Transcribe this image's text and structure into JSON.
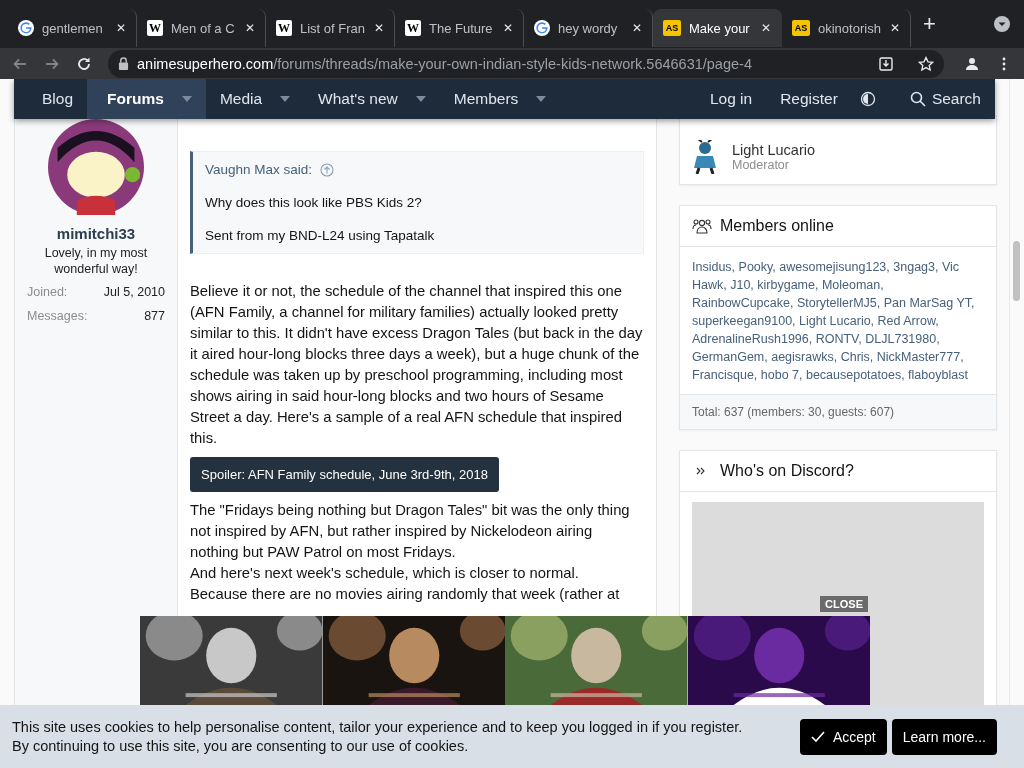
{
  "browser": {
    "tabs": [
      {
        "title": "gentlemen",
        "kind": "google",
        "selected": false
      },
      {
        "title": "Men of a C",
        "kind": "wiki",
        "badge": "W",
        "selected": false
      },
      {
        "title": "List of Fran",
        "kind": "wiki",
        "badge": "W",
        "selected": false
      },
      {
        "title": "The Future",
        "kind": "wiki",
        "badge": "W",
        "selected": false
      },
      {
        "title": "hey wordy",
        "kind": "google",
        "selected": false
      },
      {
        "title": "Make your",
        "kind": "as",
        "badge": "AS",
        "selected": true
      },
      {
        "title": "okinotorish",
        "kind": "as",
        "badge": "AS",
        "selected": false
      }
    ],
    "new_tab": "+",
    "close_glyph": "✕",
    "url_domain": "animesuperhero.com",
    "url_path": "/forums/threads/make-your-own-indian-style-kids-network.5646631/page-4"
  },
  "nav": {
    "items": [
      {
        "label": "Blog",
        "dropdown": false,
        "selected": false
      },
      {
        "label": "Forums",
        "dropdown": true,
        "selected": true
      },
      {
        "label": "Media",
        "dropdown": true,
        "selected": false
      },
      {
        "label": "What's new",
        "dropdown": true,
        "selected": false
      },
      {
        "label": "Members",
        "dropdown": true,
        "selected": false
      }
    ],
    "login": "Log in",
    "register": "Register",
    "search": "Search"
  },
  "post": {
    "user": {
      "name": "mimitchi33",
      "title": "Lovely, in my most wonderful way!",
      "stats": [
        {
          "label": "Joined:",
          "value": "Jul 5, 2010"
        },
        {
          "label": "Messages:",
          "value": "877"
        }
      ]
    },
    "quote": {
      "author": "Vaughn Max said:",
      "lines": [
        "Why does this look like PBS Kids 2?",
        "Sent from my BND-L24 using Tapatalk"
      ]
    },
    "paragraph": "Believe it or not, the schedule of the channel that inspired this one (AFN Family, a channel for military families) actually looked pretty similar to this. It didn't have excess Dragon Tales (but back in the day it aired hour-long blocks three days a week), but a huge chunk of the schedule was taken up by preschool programming, including most shows airing in said hour-long blocks and two hours of Sesame Street a day. Here's a sample of a real AFN schedule that inspired this.",
    "spoiler": "Spoiler: AFN Family schedule, June 3rd-9th, 2018",
    "after": [
      "The \"Fridays being nothing but Dragon Tales\" bit was the only thing not inspired by AFN, but rather inspired by Nickelodeon airing nothing but PAW Patrol on most Fridays.",
      "And here's next week's schedule, which is closer to normal.",
      "Because there are no movies airing randomly that week (rather at"
    ]
  },
  "sidebar": {
    "staff": [
      {
        "name": "Light Lucario",
        "role": "Moderator"
      }
    ],
    "members_online": {
      "title": "Members online",
      "names": "Insidus, Pooky, awesomejisung123, 3ngag3, Vic Hawk, J10, kirbygame, Moleoman, RainbowCupcake, StorytellerMJ5, Pan MarSag YT, superkeegan9100, Light Lucario, Red Arrow, AdrenalineRush1996, RONTV, DLJL731980, GermanGem, aegisrawks, Chris, NickMaster777, Francisque, hobo 7, becausepotatoes, flaboyblast",
      "total": "Total: 637 (members: 30, guests: 607)"
    },
    "discord": {
      "title": "Who's on Discord?"
    }
  },
  "ad": {
    "close": "CLOSE"
  },
  "cookie": {
    "lines": [
      "This site uses cookies to help personalise content, tailor your experience and to keep you logged in if you register.",
      "By continuing to use this site, you are consenting to our use of cookies."
    ],
    "accept": "Accept",
    "learn": "Learn more..."
  }
}
